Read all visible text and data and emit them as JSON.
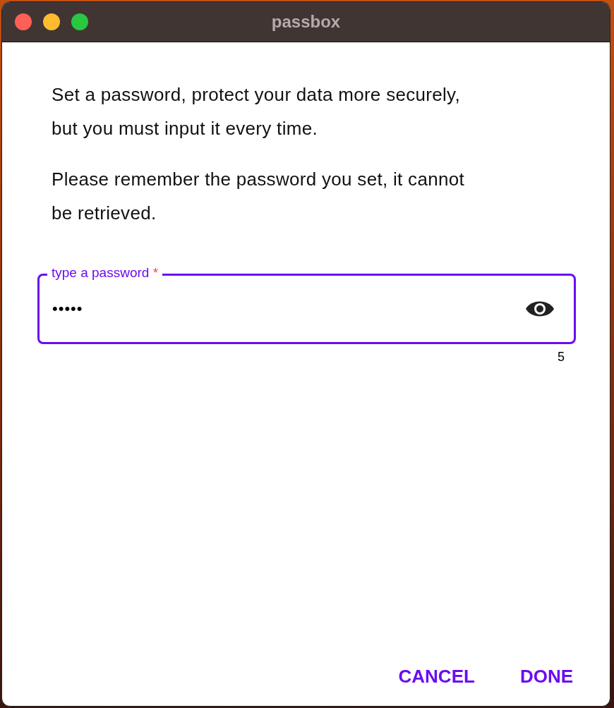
{
  "window": {
    "title": "passbox"
  },
  "paragraphs": [
    "Set a password, protect your data more securely, but you must input it every time.",
    "Please remember the password you set, it cannot be retrieved."
  ],
  "password_field": {
    "label": "type a password",
    "required_mark": "*",
    "value": "•••••",
    "focused": true,
    "counter": "5"
  },
  "buttons": [
    "CANCEL",
    "DONE"
  ]
}
